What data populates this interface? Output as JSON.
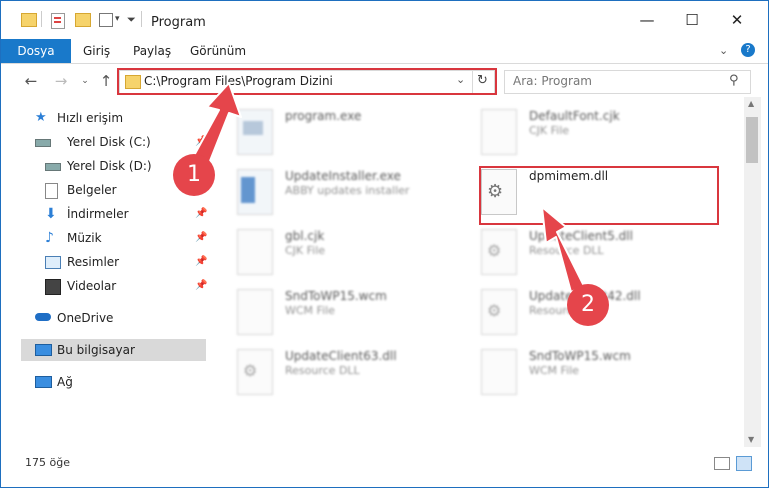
{
  "window": {
    "title": "Program",
    "minimize_glyph": "—",
    "maximize_glyph": "☐",
    "close_glyph": "✕"
  },
  "ribbon": {
    "tabs": [
      "Dosya",
      "Giriş",
      "Paylaş",
      "Görünüm"
    ]
  },
  "address": {
    "path": "C:\\Program Files\\Program Dizini"
  },
  "search": {
    "placeholder": "Ara: Program"
  },
  "sidebar": {
    "items": [
      {
        "label": "Hızlı erişim",
        "icon": "star-icon"
      },
      {
        "label": "Yerel Disk (C:)",
        "icon": "drive-icon",
        "pinned": true
      },
      {
        "label": "Yerel Disk (D:)",
        "icon": "drive-icon",
        "pinned": true
      },
      {
        "label": "Belgeler",
        "icon": "documents-icon",
        "pinned": true
      },
      {
        "label": "İndirmeler",
        "icon": "download-icon",
        "pinned": true
      },
      {
        "label": "Müzik",
        "icon": "music-icon",
        "pinned": true
      },
      {
        "label": "Resimler",
        "icon": "pictures-icon",
        "pinned": true
      },
      {
        "label": "Videolar",
        "icon": "videos-icon",
        "pinned": true
      },
      {
        "label": "OneDrive",
        "icon": "onedrive-icon"
      },
      {
        "label": "Bu bilgisayar",
        "icon": "computer-icon",
        "selected": true
      },
      {
        "label": "Ağ",
        "icon": "network-icon"
      }
    ]
  },
  "files": [
    {
      "name": "program.exe",
      "desc": ""
    },
    {
      "name": "DefaultFont.cjk",
      "desc": "CJK File"
    },
    {
      "name": "UpdateInstaller.exe",
      "desc": "ABBY updates installer"
    },
    {
      "name": "dpmimem.dll",
      "desc": ""
    },
    {
      "name": "gbl.cjk",
      "desc": "CJK File"
    },
    {
      "name": "UpdateClient5.dll",
      "desc": "Resource DLL"
    },
    {
      "name": "SndToWP15.wcm",
      "desc": "WCM File"
    },
    {
      "name": "UpdateClient42.dll",
      "desc": "Resource DLL"
    },
    {
      "name": "UpdateClient63.dll",
      "desc": "Resource DLL"
    },
    {
      "name": "SndToWP15.wcm",
      "desc": "WCM File"
    }
  ],
  "status": {
    "count": "175 öğe"
  },
  "annotations": {
    "step1": "1",
    "step2": "2",
    "color": "#e5454b"
  }
}
